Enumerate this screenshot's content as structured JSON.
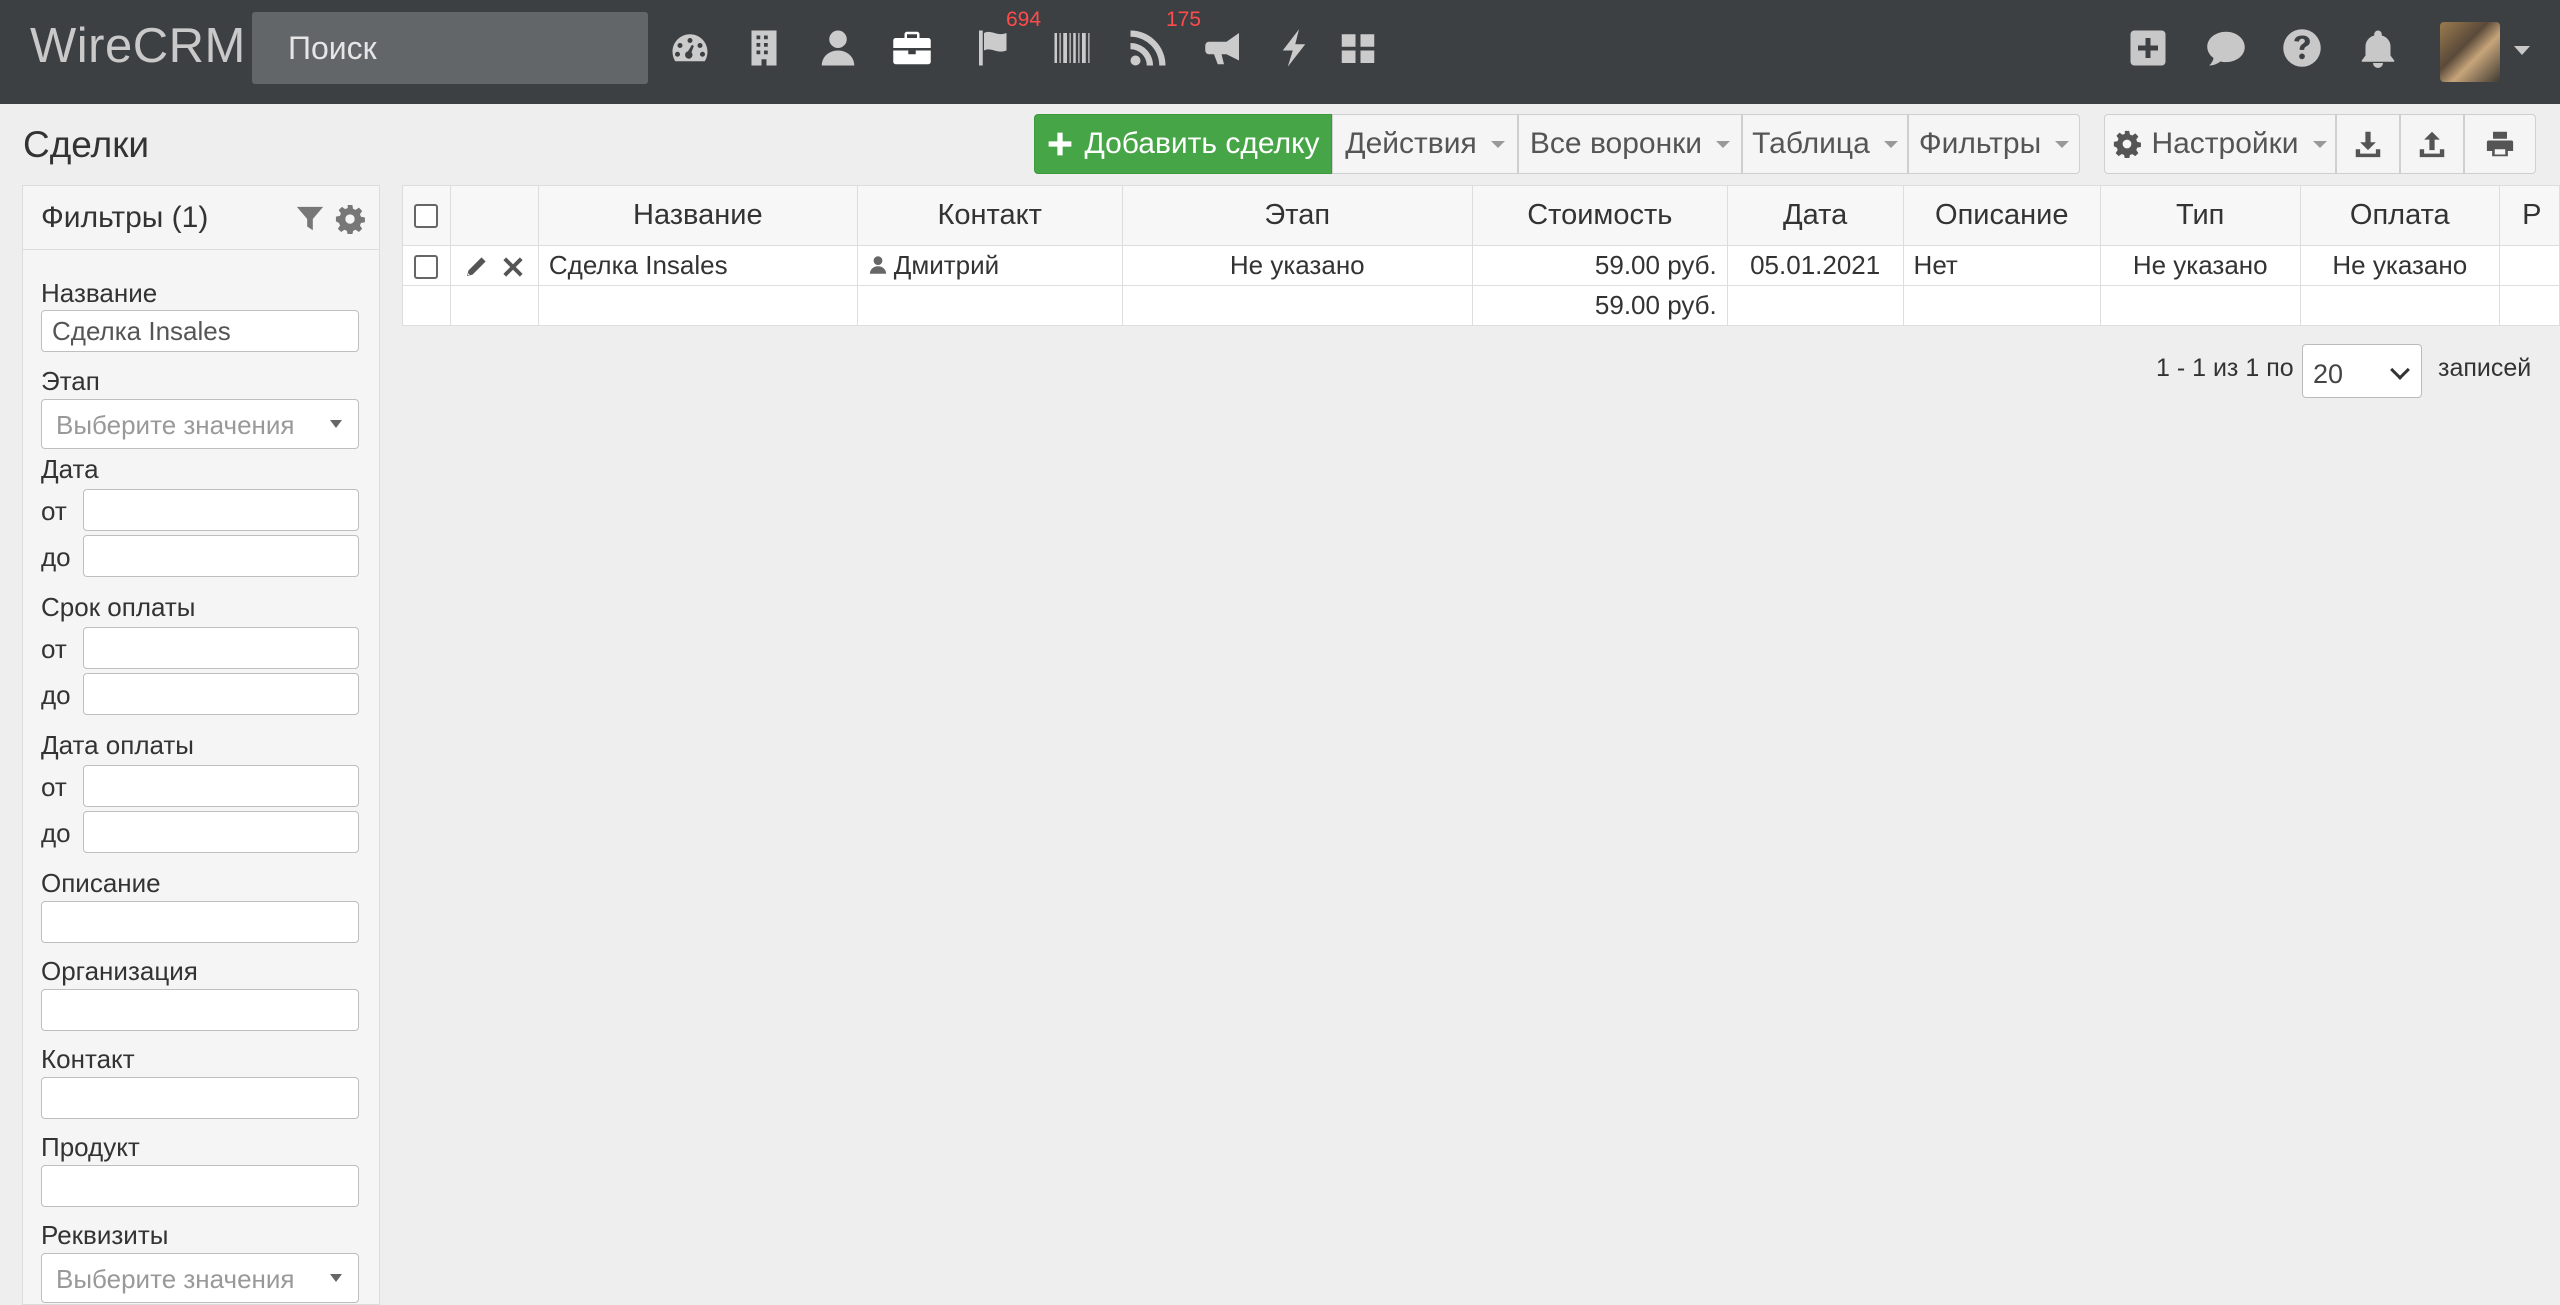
{
  "app": {
    "name": "WireCRM"
  },
  "search": {
    "placeholder": "Поиск"
  },
  "nav": {
    "icons": [
      "dashboard-icon",
      "building-icon",
      "user-icon",
      "briefcase-icon",
      "flag-icon",
      "barcode-icon",
      "rss-icon",
      "megaphone-icon",
      "bolt-icon",
      "grid-icon"
    ],
    "flag_badge": "694",
    "rss_badge": "175",
    "right_icons": [
      "plus-square-icon",
      "chat-icon",
      "help-icon",
      "bell-icon"
    ]
  },
  "page": {
    "title": "Сделки"
  },
  "toolbar": {
    "add_label": "Добавить сделку",
    "actions_label": "Действия",
    "funnels_label": "Все воронки",
    "view_label": "Таблица",
    "filters_label": "Фильтры",
    "settings_label": "Настройки"
  },
  "filters": {
    "title": "Фильтры (1)",
    "name_label": "Название",
    "name_value": "Сделка Insales",
    "stage_label": "Этап",
    "select_placeholder": "Выберите значения",
    "date_label": "Дата",
    "from": "от",
    "to": "до",
    "due_label": "Срок оплаты",
    "paid_label": "Дата оплаты",
    "desc_label": "Описание",
    "org_label": "Организация",
    "contact_label": "Контакт",
    "product_label": "Продукт",
    "req_label": "Реквизиты"
  },
  "table": {
    "columns": [
      "Название",
      "Контакт",
      "Этап",
      "Стоимость",
      "Дата",
      "Описание",
      "Тип",
      "Оплата",
      "Р"
    ],
    "rows": [
      {
        "name": "Сделка Insales",
        "contact": "Дмитрий",
        "stage": "Не указано",
        "cost": "59.00 руб.",
        "date": "05.01.2021",
        "description": "Нет",
        "type": "Не указано",
        "payment": "Не указано"
      }
    ],
    "total_cost": "59.00 руб."
  },
  "pager": {
    "info": "1 - 1 из 1 по",
    "page_size": "20",
    "label": "записей"
  },
  "colors": {
    "topbar": "#3d4043",
    "primary": "#46a546",
    "badge": "#ff4b4b",
    "negative_text": "#e0004d"
  }
}
